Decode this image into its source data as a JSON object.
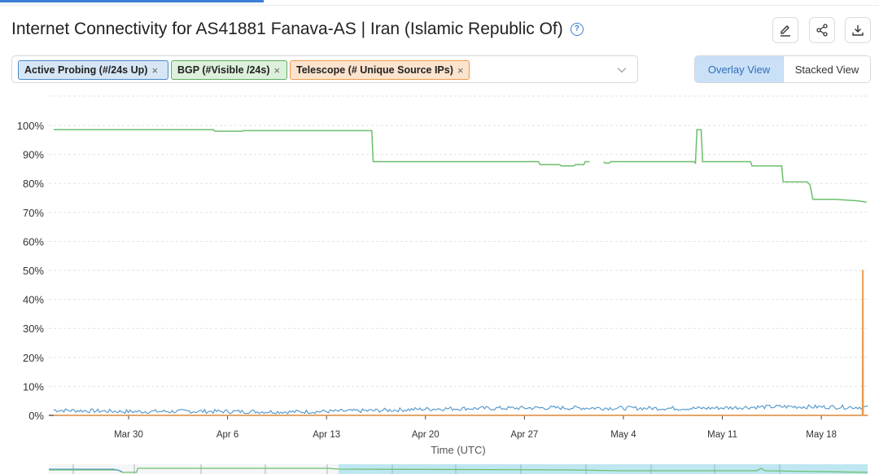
{
  "header": {
    "title": "Internet Connectivity for AS41881 Fanava-AS | Iran (Islamic Republic Of)",
    "help_icon": "question-circle-icon",
    "actions": [
      {
        "name": "edit-button",
        "icon": "pencil-icon"
      },
      {
        "name": "share-button",
        "icon": "share-icon"
      },
      {
        "name": "download-button",
        "icon": "download-icon"
      }
    ]
  },
  "filters": {
    "chips": [
      {
        "label": "Active Probing (#/24s Up)",
        "color": "#4a88c6"
      },
      {
        "label": "BGP (#Visible /24s)",
        "color": "#5fae5f"
      },
      {
        "label": "Telescope (# Unique Source IPs)",
        "color": "#eb9a4c"
      }
    ],
    "remove_glyph": "×"
  },
  "view_toggle": {
    "overlay_label": "Overlay View",
    "stacked_label": "Stacked View",
    "active": "overlay"
  },
  "chart_data": {
    "type": "line",
    "title": "",
    "xlabel": "Time (UTC)",
    "ylabel": "",
    "x_tick_labels": [
      "Mar 30",
      "Apr 6",
      "Apr 13",
      "Apr 20",
      "Apr 27",
      "May 4",
      "May 11",
      "May 18"
    ],
    "y_tick_labels": [
      "0%",
      "10%",
      "20%",
      "30%",
      "40%",
      "50%",
      "60%",
      "70%",
      "80%",
      "90%",
      "100%"
    ],
    "ylim": [
      0,
      100
    ],
    "xlim_days": [
      -5.3,
      52.3
    ],
    "x_reference": "Mar 30 = day 0",
    "grid": true,
    "series": [
      {
        "name": "BGP (#Visible /24s)",
        "color": "#6cbf6c",
        "points": [
          [
            -5.3,
            98.5
          ],
          [
            6.0,
            98.5
          ],
          [
            6.1,
            98.0
          ],
          [
            8.0,
            98.0
          ],
          [
            8.1,
            98.2
          ],
          [
            15.5,
            98.2
          ],
          [
            17.2,
            98.2
          ],
          [
            17.3,
            87.5
          ],
          [
            29.0,
            87.5
          ],
          [
            29.1,
            86.5
          ],
          [
            30.5,
            86.5
          ],
          [
            30.6,
            86.0
          ],
          [
            31.5,
            86.0
          ],
          [
            31.6,
            86.5
          ],
          [
            32.2,
            86.5
          ],
          [
            32.3,
            87.5
          ],
          [
            32.6,
            87.5
          ],
          null,
          [
            33.6,
            87.5
          ],
          [
            33.7,
            87.0
          ],
          [
            34.0,
            87.0
          ],
          [
            34.1,
            87.5
          ],
          [
            40.0,
            87.5
          ],
          [
            40.1,
            87.0
          ],
          [
            40.2,
            98.5
          ],
          [
            40.5,
            98.5
          ],
          [
            40.6,
            87.5
          ],
          [
            44.0,
            87.5
          ],
          [
            44.1,
            86.0
          ],
          [
            46.2,
            86.0
          ],
          [
            46.3,
            80.5
          ],
          [
            48.0,
            80.5
          ],
          [
            48.2,
            79.5
          ],
          [
            48.4,
            74.5
          ],
          [
            50.0,
            74.5
          ],
          [
            51.6,
            74.0
          ],
          [
            52.2,
            73.5
          ]
        ]
      },
      {
        "name": "Active Probing (#/24s Up)",
        "color": "#4f95c8",
        "baseline": [
          [
            -5.3,
            1.8
          ],
          [
            0,
            1.3
          ],
          [
            5,
            1.4
          ],
          [
            12,
            1.2
          ],
          [
            17,
            1.6
          ],
          [
            22,
            2.3
          ],
          [
            30,
            2.6
          ],
          [
            40,
            2.4
          ],
          [
            46,
            3.0
          ],
          [
            52.3,
            2.8
          ]
        ]
      },
      {
        "name": "Telescope (# Unique Source IPs)",
        "color": "#eb9a4c",
        "points": [
          [
            -5.3,
            0
          ],
          [
            51.9,
            0
          ],
          [
            51.92,
            50
          ],
          [
            51.95,
            50
          ],
          [
            51.97,
            0
          ],
          [
            52.3,
            0
          ]
        ]
      }
    ]
  },
  "overview_strip": {
    "highlight_color": "#bfe7f2"
  }
}
